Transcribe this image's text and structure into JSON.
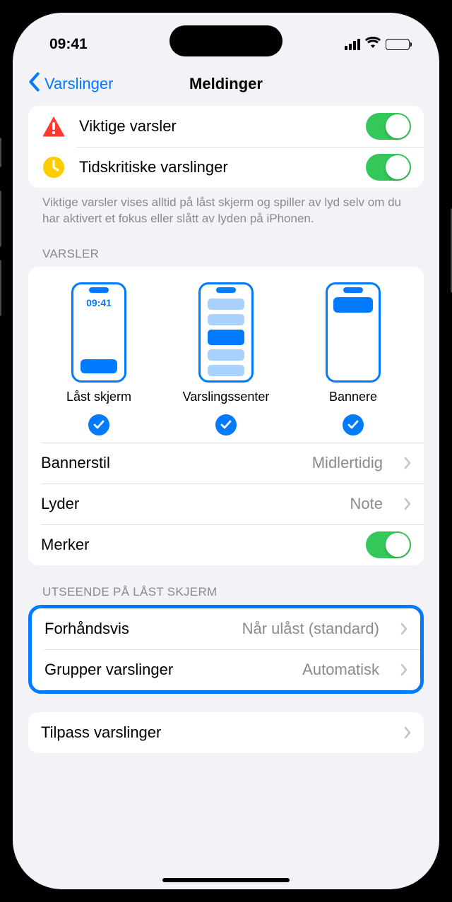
{
  "status": {
    "time": "09:41"
  },
  "nav": {
    "back_label": "Varslinger",
    "title": "Meldinger"
  },
  "critical": {
    "important_label": "Viktige varsler",
    "time_sensitive_label": "Tidskritiske varslinger",
    "footer": "Viktige varsler vises alltid på låst skjerm og spiller av lyd selv om du har aktivert et fokus eller slått av lyden på iPhonen."
  },
  "alerts": {
    "header": "VARSLER",
    "lock_screen_label": "Låst skjerm",
    "notif_center_label": "Varslingssenter",
    "banners_label": "Bannere",
    "lock_screen_time": "09:41",
    "banner_style_label": "Bannerstil",
    "banner_style_value": "Midlertidig",
    "sounds_label": "Lyder",
    "sounds_value": "Note",
    "badges_label": "Merker"
  },
  "lockscreen": {
    "header": "UTSEENDE PÅ LÅST SKJERM",
    "preview_label": "Forhåndsvis",
    "preview_value": "Når ulåst (standard)",
    "grouping_label": "Grupper varslinger",
    "grouping_value": "Automatisk"
  },
  "customize": {
    "label": "Tilpass varslinger"
  }
}
